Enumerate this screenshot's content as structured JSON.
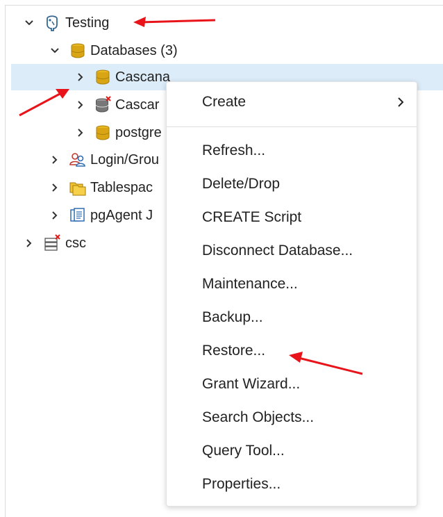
{
  "tree": {
    "server_testing": "Testing",
    "databases": "Databases (3)",
    "db_1": "Cascana",
    "db_2": "Cascar",
    "db_3": "postgre",
    "login_group": "Login/Grou",
    "tablespaces": "Tablespac",
    "pgagent": "pgAgent J",
    "server_csc": "csc"
  },
  "context_menu": {
    "create": "Create",
    "refresh": "Refresh...",
    "delete_drop": "Delete/Drop",
    "create_script": "CREATE Script",
    "disconnect": "Disconnect Database...",
    "maintenance": "Maintenance...",
    "backup": "Backup...",
    "restore": "Restore...",
    "grant_wizard": "Grant Wizard...",
    "search_objects": "Search Objects...",
    "query_tool": "Query Tool...",
    "properties": "Properties..."
  },
  "colors": {
    "selection": "#dcecf8",
    "annotation_arrow": "#e8141a",
    "database_icon": "#d9a514"
  }
}
